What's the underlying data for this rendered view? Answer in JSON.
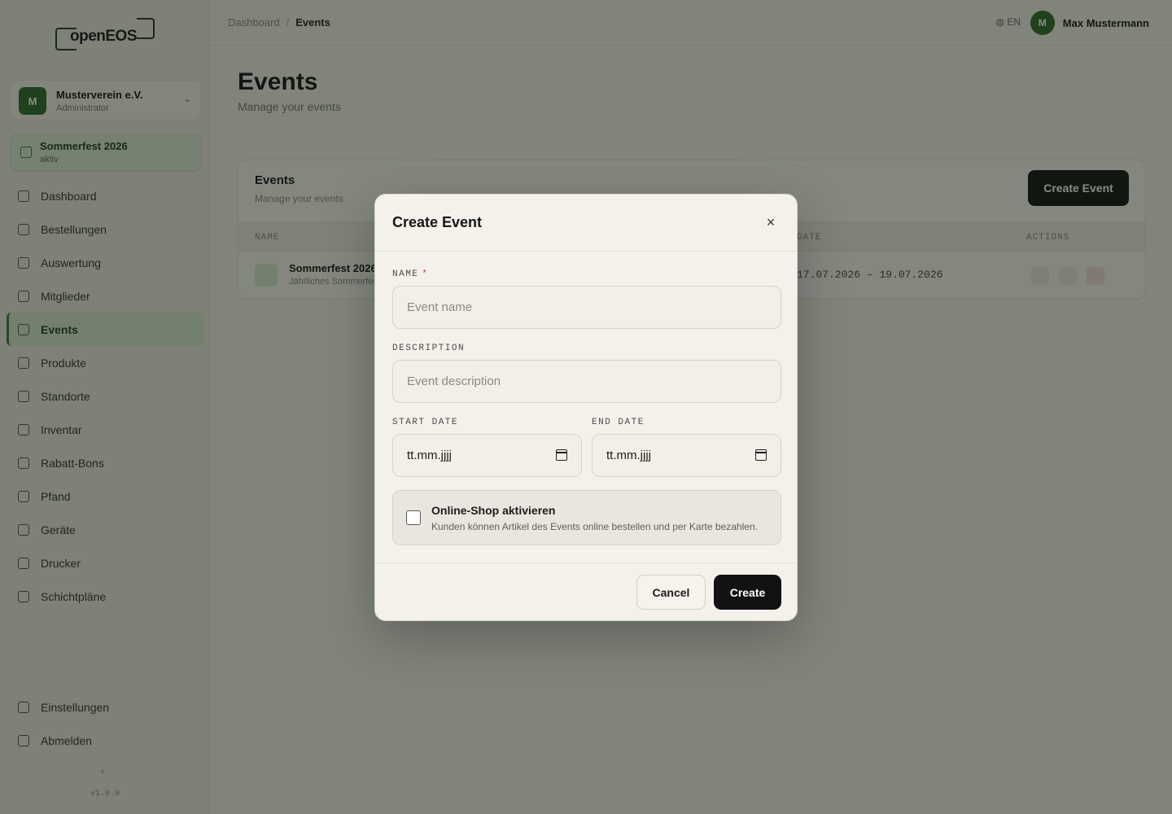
{
  "sidebar": {
    "logo_text": "openEOS",
    "org": {
      "avatar": "M",
      "name": "Musterverein e.V.",
      "sub": "Administrator"
    },
    "current_event": {
      "name": "Sommerfest 2026",
      "sub": "aktiv"
    },
    "items": [
      {
        "label": "Dashboard",
        "icon": "dashboard-icon"
      },
      {
        "label": "Bestellungen",
        "icon": "orders-icon"
      },
      {
        "label": "Auswertung",
        "icon": "chart-icon"
      },
      {
        "label": "Mitglieder",
        "icon": "users-icon"
      },
      {
        "label": "Events",
        "icon": "calendar-icon",
        "active": true
      },
      {
        "label": "Produkte",
        "icon": "box-icon"
      },
      {
        "label": "Standorte",
        "icon": "location-icon"
      },
      {
        "label": "Inventar",
        "icon": "inventory-icon"
      },
      {
        "label": "Rabatt-Bons",
        "icon": "tag-icon"
      },
      {
        "label": "Pfand",
        "icon": "deposit-icon"
      },
      {
        "label": "Geräte",
        "icon": "device-icon"
      },
      {
        "label": "Drucker",
        "icon": "printer-icon"
      },
      {
        "label": "Schichtpläne",
        "icon": "schedule-icon"
      }
    ],
    "bottom_items": [
      {
        "label": "Einstellungen",
        "icon": "gear-icon"
      },
      {
        "label": "Abmelden",
        "icon": "logout-icon"
      }
    ],
    "collapse_glyph": "‹",
    "version": "v1.0.0"
  },
  "topbar": {
    "breadcrumb_root": "Dashboard",
    "breadcrumb_sep": "/",
    "breadcrumb_current": "Events",
    "language": "EN",
    "user_initial": "M",
    "user_name": "Max Mustermann"
  },
  "page": {
    "title": "Events",
    "subtitle": "Manage your events",
    "panel_title": "Events",
    "panel_subtitle": "Manage your events",
    "create_button": "Create Event",
    "table_headers": [
      "NAME",
      "DATE",
      "ACTIONS"
    ],
    "rows": [
      {
        "name": "Sommerfest 2026",
        "description": "Jährliches Sommerfest",
        "dates": "17.07.2026 – 19.07.2026"
      }
    ]
  },
  "dialog": {
    "title": "Create Event",
    "close_glyph": "×",
    "name_label": "NAME",
    "required_mark": "*",
    "name_placeholder": "Event name",
    "description_label": "DESCRIPTION",
    "description_placeholder": "Event description",
    "start_label": "START DATE",
    "start_value": "tt.mm.jjjj",
    "end_label": "END DATE",
    "end_value": "tt.mm.jjjj",
    "shop_title": "Online-Shop aktivieren",
    "shop_description": "Kunden können Artikel des Events online bestellen und per Karte bezahlen.",
    "shop_checked": false,
    "cancel_label": "Cancel",
    "create_label": "Create"
  }
}
